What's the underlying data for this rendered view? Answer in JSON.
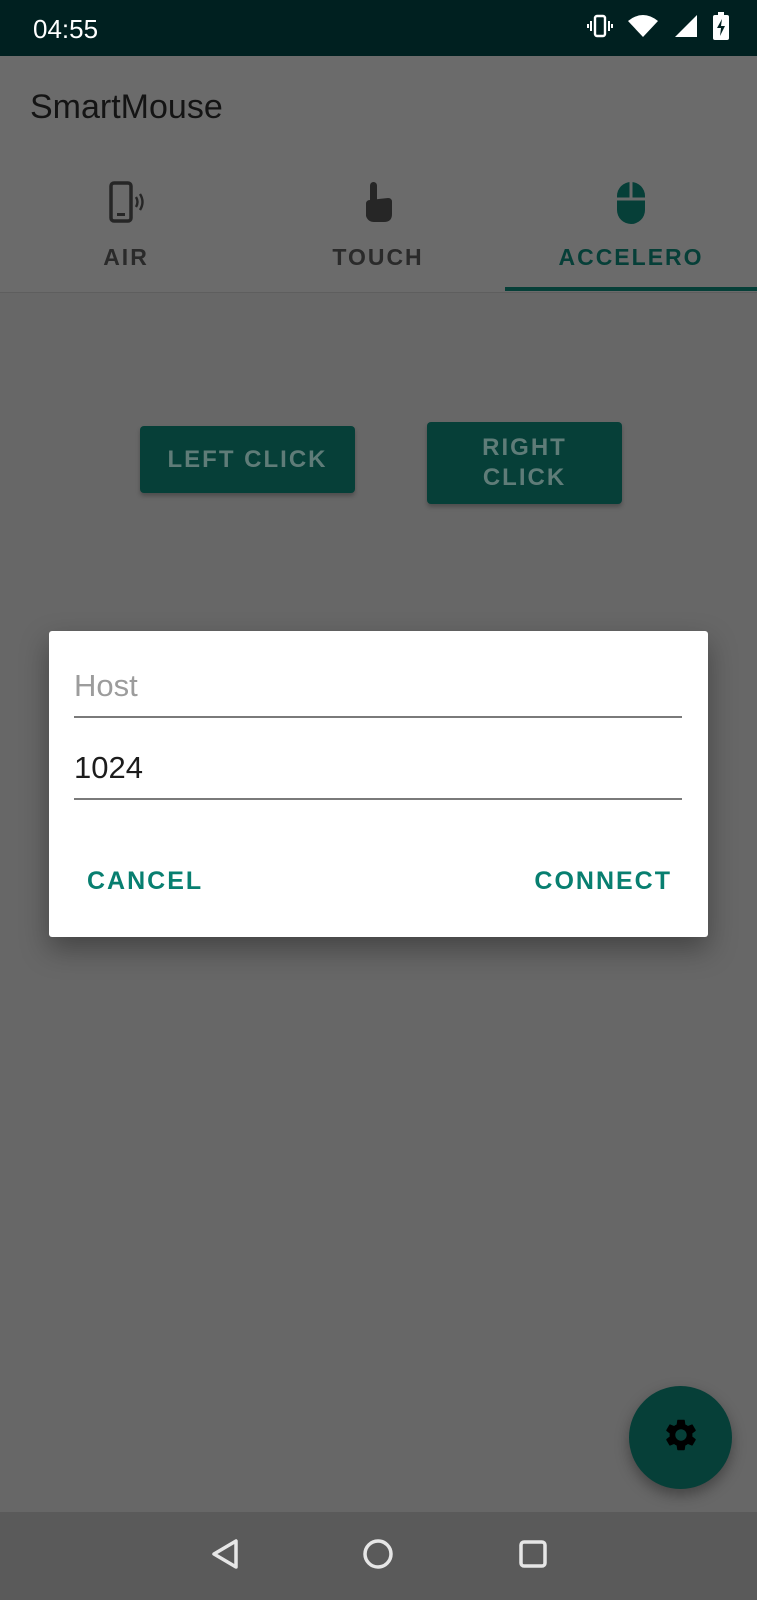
{
  "status_bar": {
    "time": "04:55",
    "icons": [
      "vibrate-icon",
      "wifi-icon",
      "signal-icon",
      "battery-charging-icon"
    ]
  },
  "app_bar": {
    "title": "SmartMouse"
  },
  "tabs": [
    {
      "label": "AIR",
      "icon": "phone-air-icon",
      "active": false
    },
    {
      "label": "TOUCH",
      "icon": "touch-icon",
      "active": false
    },
    {
      "label": "ACCELERO",
      "icon": "mouse-icon",
      "active": true
    }
  ],
  "buttons": {
    "left_click": "LEFT CLICK",
    "right_click": "RIGHT CLICK"
  },
  "dialog": {
    "host": {
      "placeholder": "Host",
      "value": ""
    },
    "port": {
      "value": "1024"
    },
    "cancel_label": "CANCEL",
    "connect_label": "CONNECT"
  },
  "fab": {
    "icon": "gear-icon"
  },
  "nav_bar": {
    "icons": [
      "back-icon",
      "home-icon",
      "recents-icon"
    ]
  },
  "colors": {
    "accent": "#087f70",
    "primary_dark": "#063f38",
    "status_bar": "#002020"
  }
}
